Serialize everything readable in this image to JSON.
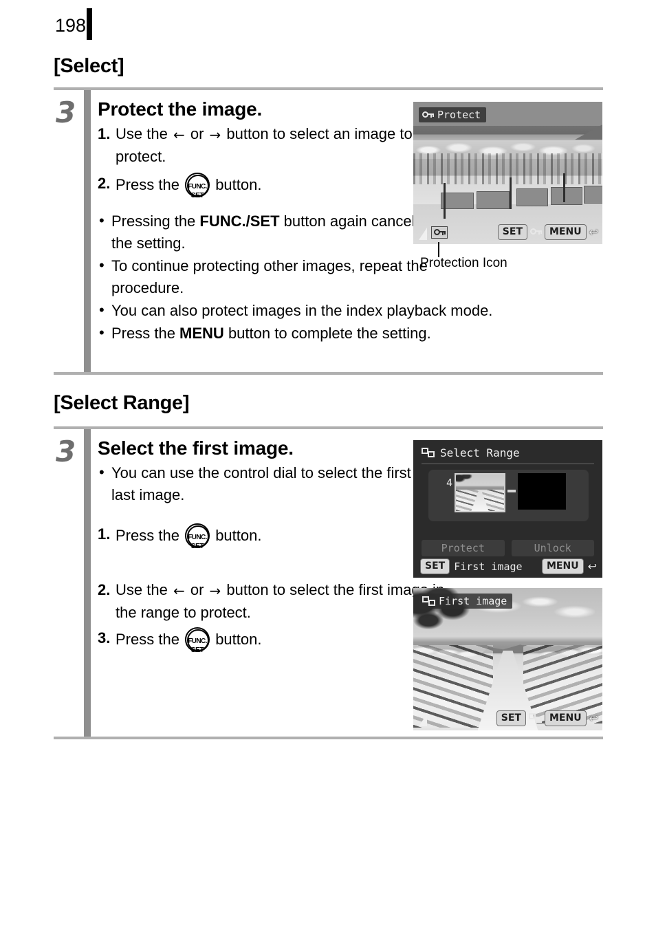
{
  "page": {
    "number": "198"
  },
  "sections": [
    {
      "title": "[Select]",
      "step_number": "3",
      "heading": "Protect the image.",
      "numbered": [
        {
          "num": "1.",
          "pre": "Use the",
          "mid": "or",
          "post": "button to select an image to protect."
        },
        {
          "num": "2.",
          "pre": "Press the",
          "post": "button."
        }
      ],
      "bullets": [
        {
          "pre": "Pressing the ",
          "bold": "FUNC./SET",
          "post": " button again cancels the setting."
        },
        {
          "pre": "To continue protecting other images, repeat the procedure.",
          "bold": "",
          "post": ""
        },
        {
          "pre": "You can also protect images in the index playback mode.",
          "bold": "",
          "post": ""
        },
        {
          "pre": "Press the ",
          "bold": "MENU",
          "post": " button to complete the setting."
        }
      ],
      "callout": "Protection Icon"
    },
    {
      "title": "[Select Range]",
      "step_number": "3",
      "heading": "Select the first image.",
      "bullets": [
        {
          "pre": "You can use the control dial to select the first or last image.",
          "bold": "",
          "post": ""
        }
      ],
      "numbered": [
        {
          "num": "1.",
          "pre": "Press the",
          "post": "button."
        },
        {
          "num": "2.",
          "pre": "Use the",
          "mid": "or",
          "post": "button to select the first image in the range to protect."
        },
        {
          "num": "3.",
          "pre": "Press the",
          "post": "button."
        }
      ]
    }
  ],
  "screens": {
    "protect": {
      "badge_label": "Protect",
      "badge_icon": "key-icon",
      "bottom": {
        "set_label": "SET",
        "mode_icon": "key-icon",
        "menu_label": "MENU",
        "return_icon": "return-arrow-icon"
      }
    },
    "select_range": {
      "title": "Select Range",
      "title_icon": "range-icon",
      "thumb_index": "4",
      "actions": [
        "Protect",
        "Unlock"
      ],
      "footer_left": {
        "set_label": "SET",
        "text": "First image"
      },
      "footer_right": {
        "menu_label": "MENU",
        "return_icon": "return-arrow-icon"
      }
    },
    "first_image": {
      "badge_label": "First image",
      "badge_icon": "range-icon",
      "bottom": {
        "set_label": "SET",
        "mode_icon": "range-icon",
        "menu_label": "MENU",
        "return_icon": "return-arrow-icon"
      }
    }
  },
  "glyphs": {
    "arrow_left": "←",
    "arrow_right": "→",
    "bullet": "•",
    "return_arrow": "↩",
    "func_top": "FUNC.",
    "func_bottom": "SET"
  }
}
